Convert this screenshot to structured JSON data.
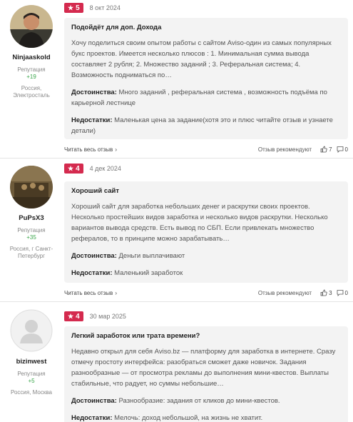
{
  "reviews": [
    {
      "username": "Ninjaaskold",
      "rep_label": "Репутация",
      "rep_value": "+19",
      "location": "Россия, Электросталь",
      "rating": "5",
      "date": "8 окт 2024",
      "title": "Подойдёт для доп. Дохода",
      "text": "Хочу поделиться своим опытом работы с сайтом Aviso-один из самых популярных букс проектов. Имеется несколько плюсов : 1. Минимальная сумма вывода составляет 2 рубля; 2. Множество заданий ; 3. Реферальная система; 4. Возможность подниматься по…",
      "pros_label": "Достоинства:",
      "pros": "Много заданий , реферальная система , возможность подъёма по карьерной лестнице",
      "cons_label": "Недостатки:",
      "cons": "Маленькая цена за задание(хотя это и плюс читайте отзыв и узнаете детали)",
      "read_all": "Читать весь отзыв",
      "recommends": "Отзыв рекомендуют",
      "likes": "7",
      "comments": "0"
    },
    {
      "username": "PuPsX3",
      "rep_label": "Репутация",
      "rep_value": "+35",
      "location": "Россия, г Санкт-Петербург",
      "rating": "4",
      "date": "4 дек 2024",
      "title": "Хороший сайт",
      "text": "Хороший сайт для заработка небольших денег и раскрутки своих проектов. Несколько простейших видов заработка и несколько видов раскрутки. Несколько вариантов вывода средств. Есть вывод по СБП. Если привлекать множество рефералов, то в принципе можно зарабатывать…",
      "pros_label": "Достоинства:",
      "pros": "Деньги выплачивают",
      "cons_label": "Недостатки:",
      "cons": "Маленький заработок",
      "read_all": "Читать весь отзыв",
      "recommends": "Отзыв рекомендуют",
      "likes": "3",
      "comments": "0"
    },
    {
      "username": "bizinwest",
      "rep_label": "Репутация",
      "rep_value": "+5",
      "location": "Россия, Москва",
      "rating": "4",
      "date": "30 мар 2025",
      "title": "Легкий заработок или трата времени?",
      "text": "Недавно открыл для себя Aviso.bz — платформу для заработка в интернете. Сразу отмечу простоту интерфейса: разобраться сможет даже новичок. Задания разнообразные — от просмотра рекламы до выполнения мини-квестов. Выплаты стабильные, что радует, но суммы небольшие…",
      "pros_label": "Достоинства:",
      "pros": "Разнообразие: задания от кликов до мини-квестов.",
      "cons_label": "Недостатки:",
      "cons": "Мелочь: доход небольшой, на жизнь не хватит."
    }
  ]
}
